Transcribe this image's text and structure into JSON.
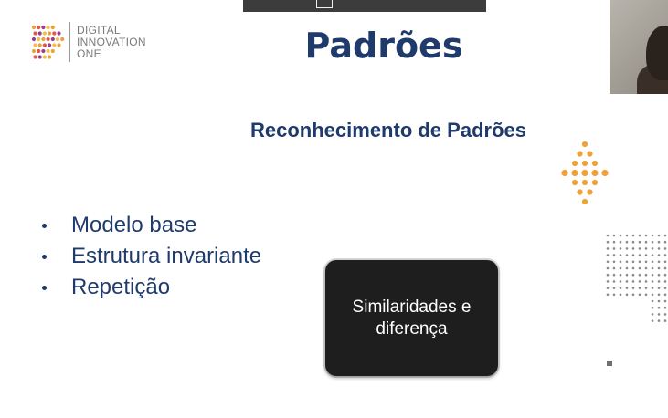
{
  "logo": {
    "line1": "DIGITAL",
    "line2": "INNOVATION",
    "line3": "ONE",
    "mark_colors": [
      "#e9a23b",
      "#e3574a",
      "#9b3e8f",
      "#f3c049"
    ]
  },
  "slide": {
    "title": "Padrões",
    "subtitle": "Reconhecimento de Padrões",
    "bullets": [
      "Modelo base",
      "Estrutura invariante",
      "Repetição"
    ],
    "callout": "Similaridades e diferença"
  },
  "colors": {
    "title_blue": "#1f3b6b",
    "accent_orange": "#f0a23a",
    "callout_bg": "#1e1e1e",
    "decor_gray": "#8a8a8a"
  },
  "icons": {
    "toolbar": "screen-share-icon",
    "logo": "dio-logo-icon",
    "decor_orange": "orange-dot-pattern",
    "decor_gray": "gray-dot-pattern"
  }
}
